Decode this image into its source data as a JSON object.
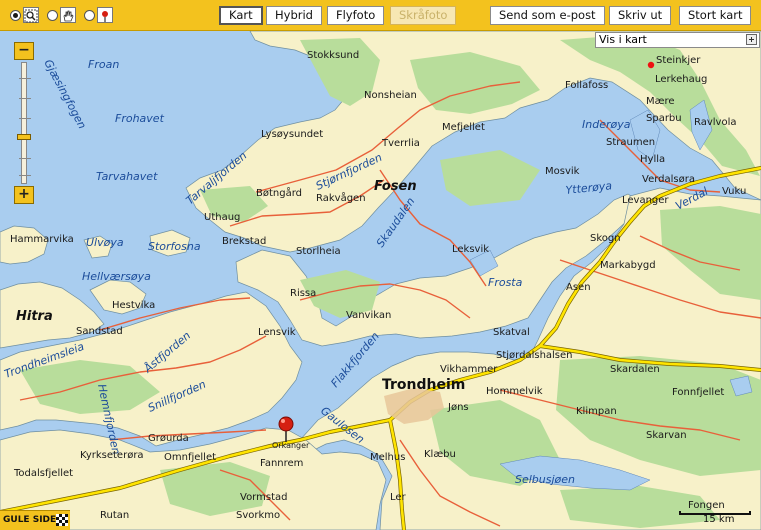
{
  "toolbar": {
    "buttons": {
      "kart": "Kart",
      "hybrid": "Hybrid",
      "flyfoto": "Flyfoto",
      "skrafoto": "Skråfoto",
      "email": "Send som e-post",
      "print": "Skriv ut",
      "large": "Stort kart"
    },
    "tool_icons": [
      "zoom-select-icon",
      "pan-hand-icon",
      "place-marker-icon"
    ]
  },
  "vis_i_kart": {
    "label": "Vis i kart"
  },
  "zoom": {
    "plus": "+",
    "minus": "−",
    "level_fraction": 0.38
  },
  "logo": {
    "text": "GULE SIDER"
  },
  "scale": {
    "label": "15 km"
  },
  "colors": {
    "sea": "#a9cdef",
    "land": "#f7f1c9",
    "forest": "#b8dd9b",
    "toolbar": "#f3c21e",
    "road_main": "#ffe400",
    "road_secondary": "#e8603a",
    "water_label": "#1b4c9a"
  },
  "map": {
    "water_labels": [
      "Froan",
      "Frohavet",
      "Gjæsingfogen",
      "Tarvahavet",
      "Tarvaljfjorden",
      "Ulvøya",
      "Storfosna",
      "Hellværsøya",
      "Trondheimsleia",
      "Hemnfjorden",
      "Åstfjorden",
      "Snillfjorden",
      "Stjørnfjorden",
      "Skaudalen",
      "Flakkfjorden",
      "Gaulosen",
      "Inderøya",
      "Ytterøya",
      "Frosta",
      "Verdal",
      "Selbusjøen"
    ],
    "place_labels": [
      "Stokksund",
      "Nonsheian",
      "Follafoss",
      "Steinkjer",
      "Lerkehaug",
      "Mære",
      "Sparbu",
      "Ravlvola",
      "Lysøysundet",
      "Tverrlia",
      "Mefjellet",
      "Straumen",
      "Hylla",
      "Verdalsøra",
      "Bøtngård",
      "Rakvågen",
      "Mosvik",
      "Vuku",
      "Levanger",
      "Uthaug",
      "Brekstad",
      "Storlheia",
      "Leksvik",
      "Skogn",
      "Hammarvika",
      "Markabygd",
      "Rissa",
      "Asen",
      "Hestvika",
      "Vanvikan",
      "Sandstad",
      "Lensvik",
      "Skatval",
      "Stjørdalshalsen",
      "Vikhammer",
      "Hommelvik",
      "Skardalen",
      "Jøns",
      "Klimpan",
      "Fonnfjellet",
      "Grøurda",
      "Omnfjellet",
      "Orkanger",
      "Kyrkseterøra",
      "Fannrem",
      "Melhus",
      "Klæbu",
      "Skarvan",
      "Todalsfjellet",
      "Vormstad",
      "Ler",
      "Svorkmo",
      "Rutan",
      "Fongen"
    ],
    "bold_labels": [
      "Fosen",
      "Hitra",
      "Trondheim"
    ],
    "marker": {
      "name": "Orkanger",
      "icon": "map-pin-icon"
    }
  }
}
